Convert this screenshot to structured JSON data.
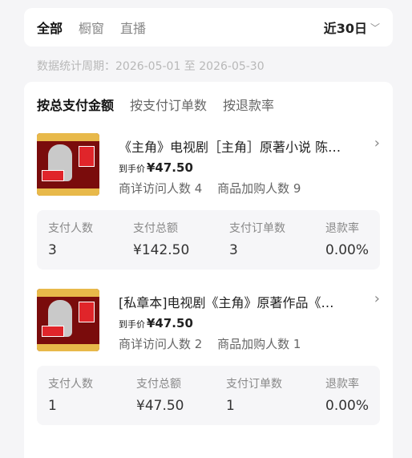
{
  "topbar": {
    "tabs": [
      "全部",
      "橱窗",
      "直播"
    ],
    "period": "近30日"
  },
  "stats_period": "数据统计周期：2026-05-01 至 2026-05-30",
  "sort_tabs": [
    "按总支付金额",
    "按支付订单数",
    "按退款率"
  ],
  "products": [
    {
      "title": "《主角》电视剧［主角］原著小说 陈…",
      "price_label": "到手价",
      "price": "¥47.50",
      "visits_label": "商详访问人数 4",
      "cart_label": "商品加购人数 9",
      "metrics": [
        {
          "label": "支付人数",
          "value": "3"
        },
        {
          "label": "支付总额",
          "value": "¥142.50"
        },
        {
          "label": "支付订单数",
          "value": "3"
        },
        {
          "label": "退款率",
          "value": "0.00%"
        }
      ]
    },
    {
      "title": "[私章本]电视剧《主角》原著作品《…",
      "price_label": "到手价",
      "price": "¥47.50",
      "visits_label": "商详访问人数 2",
      "cart_label": "商品加购人数 1",
      "metrics": [
        {
          "label": "支付人数",
          "value": "1"
        },
        {
          "label": "支付总额",
          "value": "¥47.50"
        },
        {
          "label": "支付订单数",
          "value": "1"
        },
        {
          "label": "退款率",
          "value": "0.00%"
        }
      ]
    }
  ]
}
